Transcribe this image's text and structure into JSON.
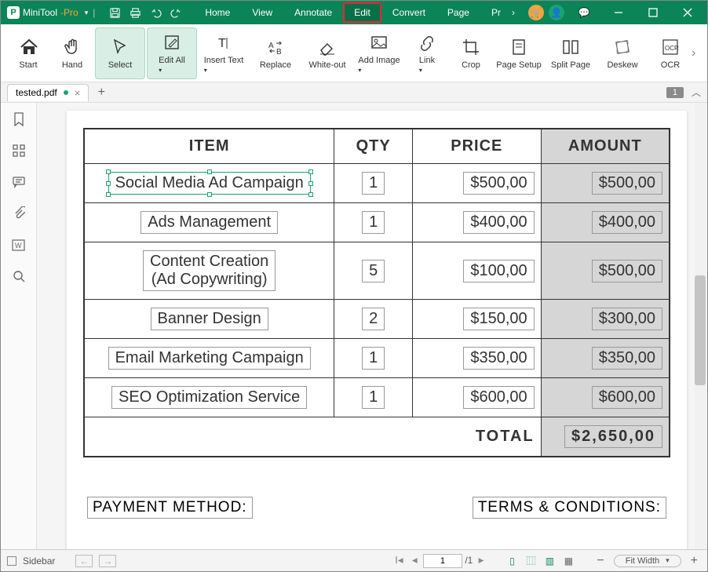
{
  "brand": {
    "p1": "MiniTool",
    "p2": "-Pro"
  },
  "menu": [
    "Home",
    "View",
    "Annotate",
    "Edit",
    "Convert",
    "Page",
    "Pr"
  ],
  "menu_active_index": 3,
  "ribbon": [
    {
      "label": "Start",
      "icon": "home"
    },
    {
      "label": "Hand",
      "icon": "hand"
    },
    {
      "label": "Select",
      "icon": "cursor",
      "sel": true
    },
    {
      "label": "Edit All",
      "icon": "editall",
      "sel": true,
      "drop": true
    },
    {
      "label": "Insert Text",
      "icon": "text",
      "drop": true
    },
    {
      "label": "Replace",
      "icon": "replace"
    },
    {
      "label": "White-out",
      "icon": "eraser"
    },
    {
      "label": "Add Image",
      "icon": "image",
      "drop": true
    },
    {
      "label": "Link",
      "icon": "link",
      "drop": true
    },
    {
      "label": "Crop",
      "icon": "crop"
    },
    {
      "label": "Page Setup",
      "icon": "pagesetup"
    },
    {
      "label": "Split Page",
      "icon": "split"
    },
    {
      "label": "Deskew",
      "icon": "deskew"
    },
    {
      "label": "OCR",
      "icon": "ocr"
    }
  ],
  "doc_tab": {
    "name": "tested.pdf"
  },
  "page_badge": "1",
  "table": {
    "headers": {
      "item": "ITEM",
      "qty": "QTY",
      "price": "PRICE",
      "amount": "AMOUNT"
    },
    "rows": [
      {
        "item": "Social Media Ad Campaign",
        "qty": "1",
        "price": "$500,00",
        "amount": "$500,00",
        "sel": true
      },
      {
        "item": "Ads Management",
        "qty": "1",
        "price": "$400,00",
        "amount": "$400,00"
      },
      {
        "item": "Content Creation\n(Ad Copywriting)",
        "qty": "5",
        "price": "$100,00",
        "amount": "$500,00"
      },
      {
        "item": "Banner Design",
        "qty": "2",
        "price": "$150,00",
        "amount": "$300,00"
      },
      {
        "item": "Email Marketing Campaign",
        "qty": "1",
        "price": "$350,00",
        "amount": "$350,00"
      },
      {
        "item": "SEO Optimization Service",
        "qty": "1",
        "price": "$600,00",
        "amount": "$600,00"
      }
    ],
    "total_label": "TOTAL",
    "total_value": "$2,650,00"
  },
  "headings": {
    "left": "PAYMENT METHOD:",
    "right": "TERMS & CONDITIONS:"
  },
  "status": {
    "sidebar": "Sidebar",
    "page_current": "1",
    "page_total": "/1",
    "fit": "Fit Width"
  }
}
